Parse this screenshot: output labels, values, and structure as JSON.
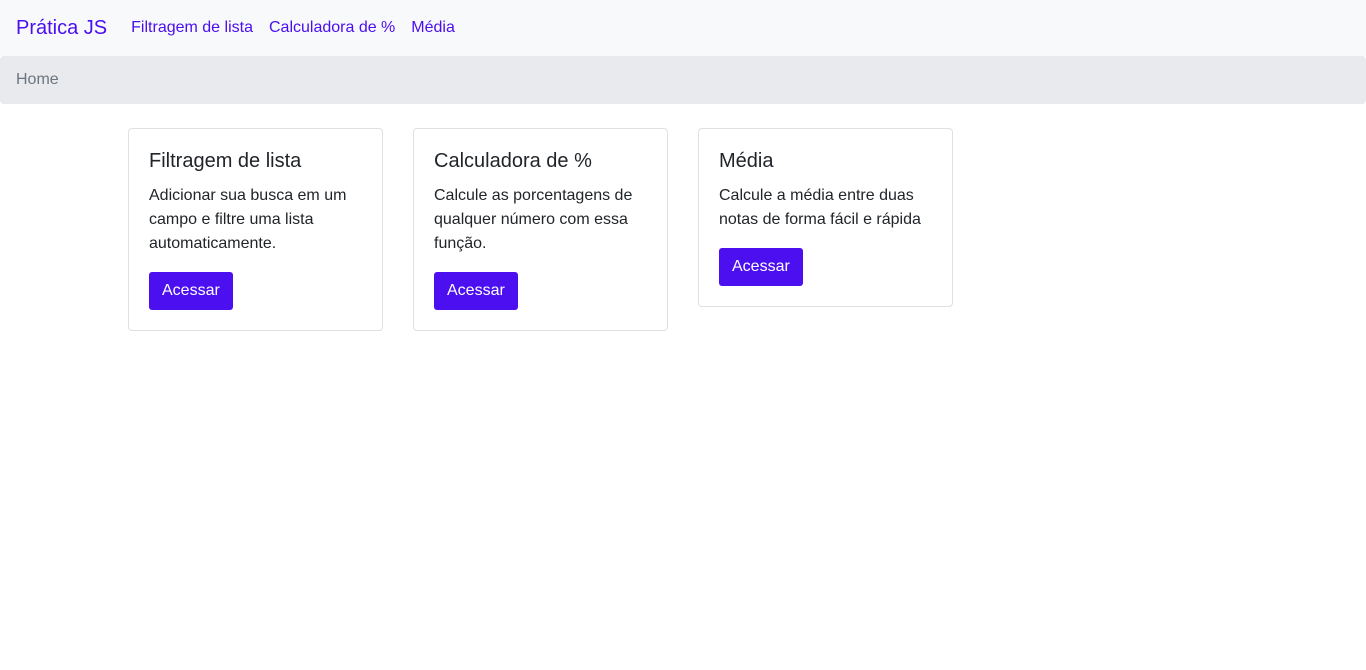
{
  "navbar": {
    "brand": "Prática JS",
    "links": [
      {
        "label": "Filtragem de lista"
      },
      {
        "label": "Calculadora de %"
      },
      {
        "label": "Média"
      }
    ]
  },
  "breadcrumb": {
    "current": "Home"
  },
  "cards": [
    {
      "title": "Filtragem de lista",
      "text": "Adicionar sua busca em um campo e filtre uma lista automaticamente.",
      "button": "Acessar"
    },
    {
      "title": "Calculadora de %",
      "text": "Calcule as porcentagens de qualquer número com essa função.",
      "button": "Acessar"
    },
    {
      "title": "Média",
      "text": "Calcule a média entre duas notas de forma fácil e rápida",
      "button": "Acessar"
    }
  ],
  "colors": {
    "accent": "#4b0ff0",
    "navbar_bg": "#f8f9fa",
    "breadcrumb_bg": "#e9eaee",
    "muted_text": "#6c757d"
  }
}
